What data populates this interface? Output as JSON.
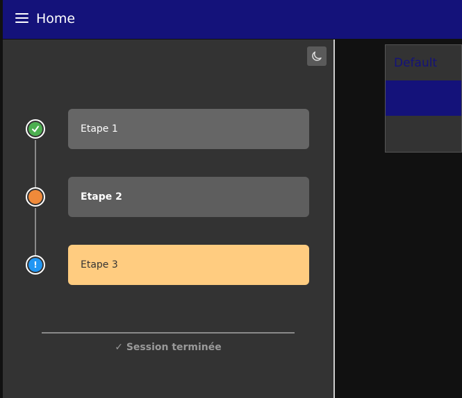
{
  "appbar": {
    "title": "Home",
    "color": "#14127a"
  },
  "sidebar": {
    "theme_toggle_icon": "moon-icon",
    "steps": [
      {
        "label": "Etape 1",
        "status": "completed",
        "icon": "check-icon",
        "dot_color": "#4caf50",
        "card_color": "#666666",
        "text_color": "#ffffff",
        "bold": false
      },
      {
        "label": "Etape 2",
        "status": "current",
        "icon": "circle-icon",
        "dot_color": "#f08a3a",
        "card_color": "#5e5e5e",
        "text_color": "#ffffff",
        "bold": true
      },
      {
        "label": "Etape 3",
        "status": "warning",
        "icon": "exclamation-icon",
        "dot_color": "#2196f3",
        "card_color": "#ffcc80",
        "text_color": "#333333",
        "bold": false
      }
    ],
    "footer": {
      "status_text": "✓ Session terminée"
    }
  },
  "dropdown": {
    "options": [
      "Default",
      "",
      ""
    ],
    "selected_index": 1,
    "accent": "#14127a"
  }
}
